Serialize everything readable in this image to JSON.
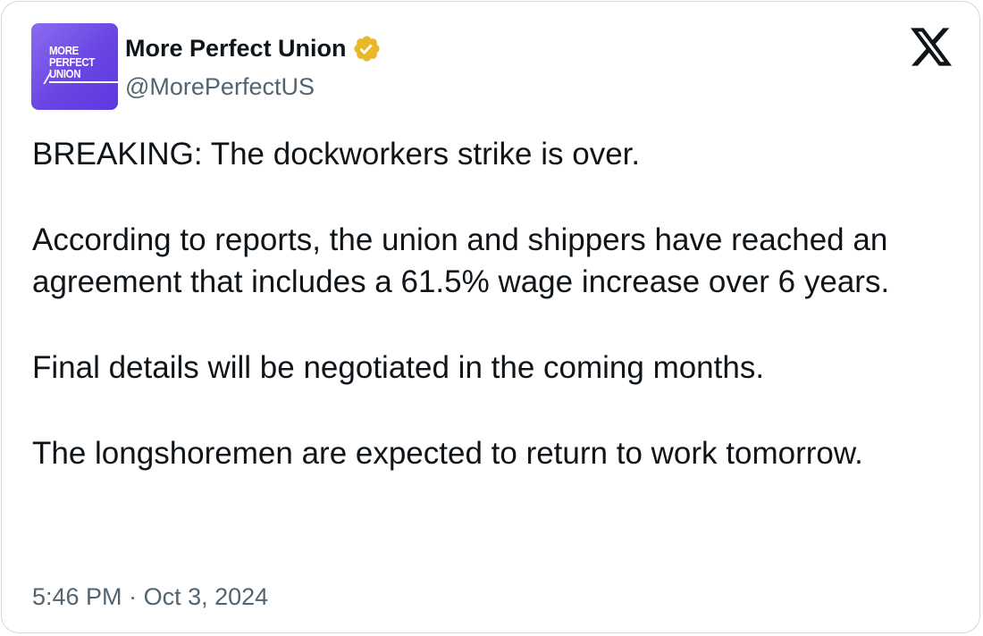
{
  "author": {
    "avatar_lines": [
      "MORE",
      "PERFECT",
      "UNION"
    ],
    "display_name": "More Perfect Union",
    "verified": true,
    "verified_badge_color": "#e8b829",
    "handle": "@MorePerfectUS",
    "avatar_colors": [
      "#8a6cf0",
      "#5e38de"
    ]
  },
  "platform_icon": "x-logo-icon",
  "tweet": {
    "paragraphs": [
      "BREAKING: The dockworkers strike is over.",
      "According to reports, the union and shippers have reached an agreement that includes a 61.5% wage increase over 6 years.",
      "Final details will be negotiated in the coming months.",
      "The longshoremen are expected to return to work tomorrow."
    ],
    "time": "5:46 PM",
    "separator": "·",
    "date": "Oct 3, 2024"
  },
  "colors": {
    "text_primary": "#0f1419",
    "text_secondary": "#536471",
    "border": "#cfd9de"
  }
}
